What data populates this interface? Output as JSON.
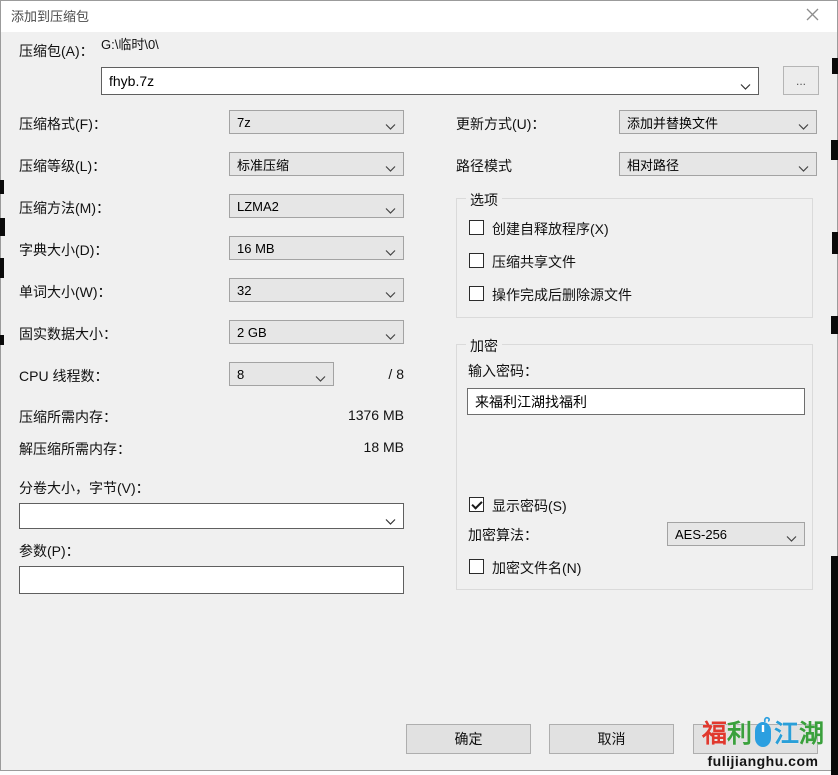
{
  "window": {
    "title": "添加到压缩包"
  },
  "archive": {
    "label": "压缩包(A)：",
    "dir_path": "G:\\临时\\0\\",
    "name_value": "fhyb.7z",
    "browse_label": "..."
  },
  "left_fields": [
    {
      "label": "压缩格式(F)：",
      "value": "7z"
    },
    {
      "label": "压缩等级(L)：",
      "value": "标准压缩"
    },
    {
      "label": "压缩方法(M)：",
      "value": "LZMA2"
    },
    {
      "label": "字典大小(D)：",
      "value": "16 MB"
    },
    {
      "label": "单词大小(W)：",
      "value": "32"
    },
    {
      "label": "固实数据大小：",
      "value": "2 GB"
    }
  ],
  "cpu": {
    "label": "CPU 线程数：",
    "value": "8",
    "suffix": "/ 8"
  },
  "memory": [
    {
      "label": "压缩所需内存：",
      "value": "1376 MB"
    },
    {
      "label": "解压缩所需内存：",
      "value": "18 MB"
    }
  ],
  "volume": {
    "label": "分卷大小，字节(V)：",
    "value": ""
  },
  "params": {
    "label": "参数(P)：",
    "value": ""
  },
  "right_fields": [
    {
      "label": "更新方式(U)：",
      "value": "添加并替换文件"
    },
    {
      "label": "路径模式",
      "value": "相对路径"
    }
  ],
  "options_group": {
    "title": "选项",
    "checkboxes": [
      {
        "label": "创建自释放程序(X)",
        "checked": false
      },
      {
        "label": "压缩共享文件",
        "checked": false
      },
      {
        "label": "操作完成后删除源文件",
        "checked": false
      }
    ]
  },
  "encrypt_group": {
    "title": "加密",
    "password_label": "输入密码：",
    "password_value": "来福利江湖找福利",
    "show_password": {
      "label": "显示密码(S)",
      "checked": true
    },
    "method_label": "加密算法：",
    "method_value": "AES-256",
    "encrypt_names": {
      "label": "加密文件名(N)",
      "checked": false
    }
  },
  "buttons": {
    "ok": "确定",
    "cancel": "取消"
  },
  "watermark": {
    "parts": [
      {
        "ch": "福",
        "color": "#e0392e"
      },
      {
        "ch": "利",
        "color": "#3aa03c"
      },
      {
        "ch": "江",
        "color": "#2a9fd8"
      },
      {
        "ch": "湖",
        "color": "#3aa03c"
      }
    ],
    "domain": "fulijianghu.com",
    "mouse_color": "#2b9fe0"
  }
}
